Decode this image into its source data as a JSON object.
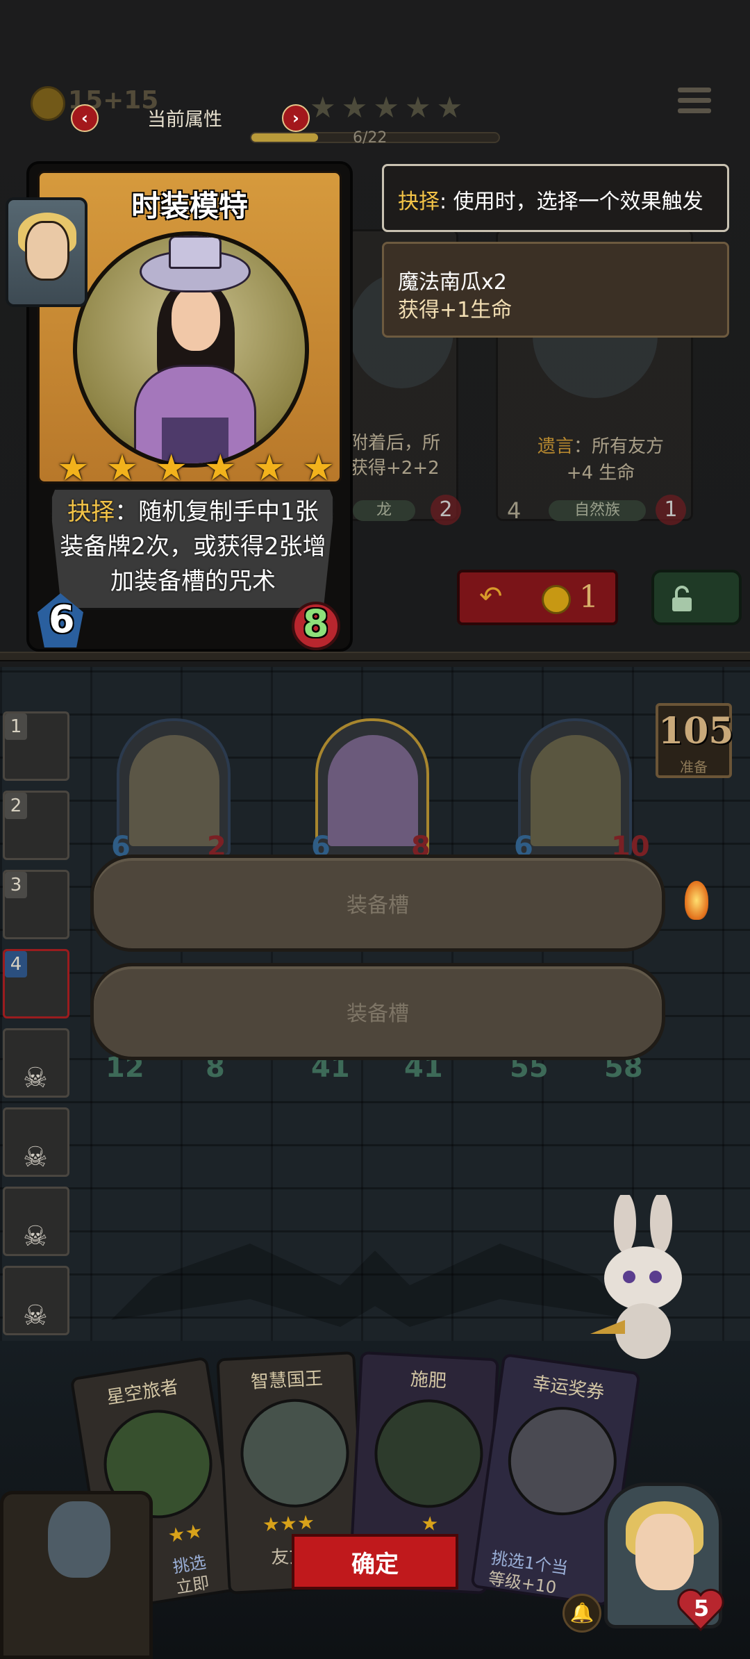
{
  "top": {
    "coins": "15+15",
    "tier_label": "当前属性",
    "stars": 5,
    "progress_text": "6/22",
    "progress_fraction": 0.27
  },
  "selected_card": {
    "title": "时装模特",
    "stars": 6,
    "keyword": "抉择",
    "desc_rest": "：随机复制手中1张装备牌2次，或获得2张增加装备槽的咒术",
    "cost": "6",
    "power": "8"
  },
  "tooltips": {
    "choose_keyword": "抉择",
    "choose_text": ": 使用时，选择一个效果触发",
    "option_title": "魔法南瓜x2",
    "option_desc": "获得+1生命"
  },
  "shop": [
    {
      "title": "",
      "text_line1": "附着后，所",
      "text_line2": "获得+2+2",
      "tag": "龙",
      "cost": "",
      "power": "2"
    },
    {
      "title": "",
      "keyword": "遗言",
      "text_line1": "：所有友方",
      "text_line2": "+4 生命",
      "tag": "自然族",
      "cost": "4",
      "power": "1"
    }
  ],
  "refresh": {
    "cost": "1"
  },
  "counter": {
    "value": "105",
    "label": "准备"
  },
  "side_slots": [
    "1",
    "2",
    "3",
    "4"
  ],
  "board_stats": [
    {
      "left": "6",
      "right": "2"
    },
    {
      "left": "6",
      "right": "8"
    },
    {
      "left": "6",
      "right": "10"
    }
  ],
  "board_lower_stats": [
    {
      "left": "12",
      "right": "8"
    },
    {
      "left": "41",
      "right": "41"
    },
    {
      "left": "55",
      "right": "58"
    }
  ],
  "slot_choices": [
    "装备槽",
    "装备槽"
  ],
  "hand": [
    {
      "title": "星空旅者",
      "snippet": "挑选",
      "snippet2": "立即"
    },
    {
      "title": "智慧国王",
      "snippet": "友方",
      "snippet2": ""
    },
    {
      "title": "施肥",
      "snippet": "",
      "snippet2": ""
    },
    {
      "title": "幸运奖券",
      "snippet": "挑选1个当",
      "snippet2": "等级+10"
    }
  ],
  "confirm_label": "确定",
  "hero": {
    "health": "5"
  },
  "colors": {
    "accent_gold": "#f2b21c",
    "confirm_red": "#c0191c",
    "keyword_yellow": "#f2c347"
  }
}
